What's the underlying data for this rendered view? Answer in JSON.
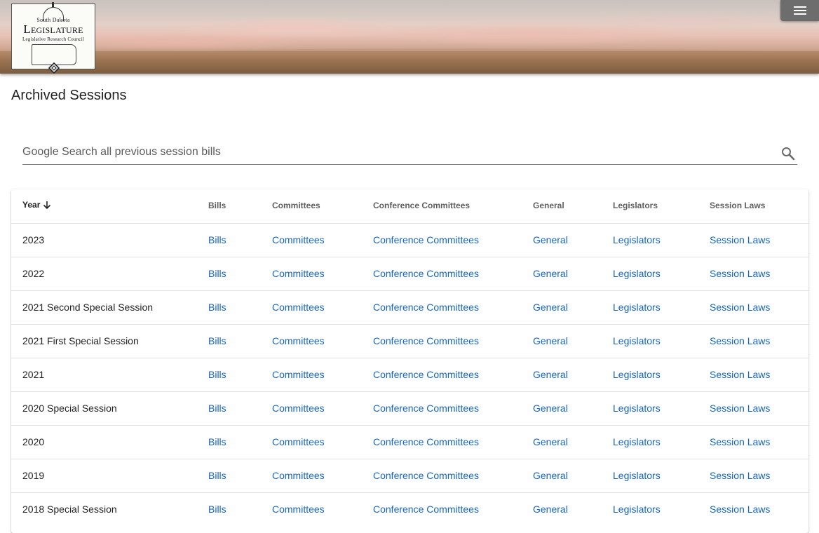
{
  "header": {
    "logo": {
      "line1": "South Dakota",
      "line2": "Legislature",
      "line3": "Legislative Research Council"
    },
    "menu_icon": "hamburger-menu-icon"
  },
  "page": {
    "title": "Archived Sessions"
  },
  "search": {
    "placeholder": "Google Search all previous session bills",
    "icon": "search-icon"
  },
  "table": {
    "columns": [
      "Year",
      "Bills",
      "Committees",
      "Conference Committees",
      "General",
      "Legislators",
      "Session Laws"
    ],
    "sort": {
      "column": "Year",
      "direction": "descending",
      "icon": "arrow-down-icon"
    },
    "rows": [
      {
        "year": "2023",
        "bills": "Bills",
        "committees": "Committees",
        "conference": "Conference Committees",
        "general": "General",
        "legislators": "Legislators",
        "session_laws": "Session Laws"
      },
      {
        "year": "2022",
        "bills": "Bills",
        "committees": "Committees",
        "conference": "Conference Committees",
        "general": "General",
        "legislators": "Legislators",
        "session_laws": "Session Laws"
      },
      {
        "year": "2021 Second Special Session",
        "bills": "Bills",
        "committees": "Committees",
        "conference": "Conference Committees",
        "general": "General",
        "legislators": "Legislators",
        "session_laws": "Session Laws"
      },
      {
        "year": "2021 First Special Session",
        "bills": "Bills",
        "committees": "Committees",
        "conference": "Conference Committees",
        "general": "General",
        "legislators": "Legislators",
        "session_laws": "Session Laws"
      },
      {
        "year": "2021",
        "bills": "Bills",
        "committees": "Committees",
        "conference": "Conference Committees",
        "general": "General",
        "legislators": "Legislators",
        "session_laws": "Session Laws"
      },
      {
        "year": "2020 Special Session",
        "bills": "Bills",
        "committees": "Committees",
        "conference": "Conference Committees",
        "general": "General",
        "legislators": "Legislators",
        "session_laws": "Session Laws"
      },
      {
        "year": "2020",
        "bills": "Bills",
        "committees": "Committees",
        "conference": "Conference Committees",
        "general": "General",
        "legislators": "Legislators",
        "session_laws": "Session Laws"
      },
      {
        "year": "2019",
        "bills": "Bills",
        "committees": "Committees",
        "conference": "Conference Committees",
        "general": "General",
        "legislators": "Legislators",
        "session_laws": "Session Laws"
      },
      {
        "year": "2018 Special Session",
        "bills": "Bills",
        "committees": "Committees",
        "conference": "Conference Committees",
        "general": "General",
        "legislators": "Legislators",
        "session_laws": "Session Laws"
      }
    ]
  },
  "colors": {
    "link": "#1565c0",
    "menu_button": "#6d6d6d",
    "header_text": "#5f5f5f"
  }
}
